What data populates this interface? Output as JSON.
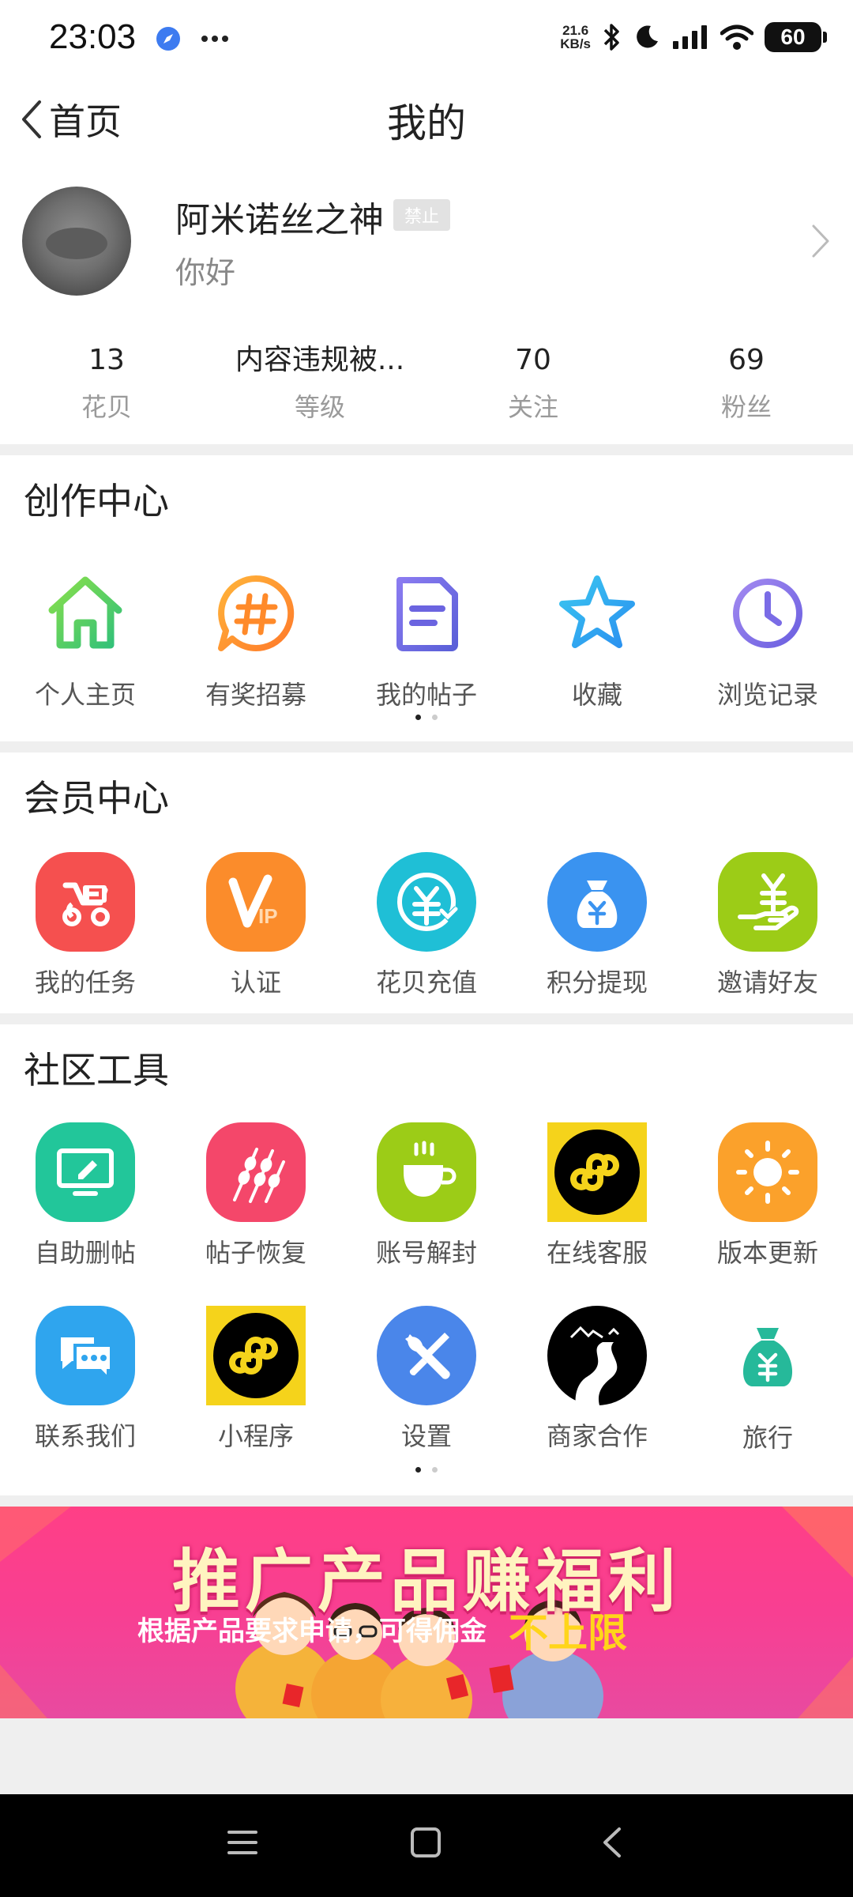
{
  "status_bar": {
    "time": "23:03",
    "net_speed_value": "21.6",
    "net_speed_unit": "KB/s",
    "battery": "60"
  },
  "nav": {
    "back_label": "首页",
    "title": "我的"
  },
  "profile": {
    "username": "阿米诺丝之神",
    "badge": "禁止",
    "signature": "你好",
    "stats": [
      {
        "value": "13",
        "label": "花贝"
      },
      {
        "value": "内容违规被...",
        "label": "等级"
      },
      {
        "value": "70",
        "label": "关注"
      },
      {
        "value": "69",
        "label": "粉丝"
      }
    ]
  },
  "creation_center": {
    "title": "创作中心",
    "items": [
      {
        "label": "个人主页",
        "icon": "home-icon"
      },
      {
        "label": "有奖招募",
        "icon": "hashtag-icon"
      },
      {
        "label": "我的帖子",
        "icon": "document-icon"
      },
      {
        "label": "收藏",
        "icon": "star-icon"
      },
      {
        "label": "浏览记录",
        "icon": "clock-icon"
      }
    ]
  },
  "member_center": {
    "title": "会员中心",
    "items": [
      {
        "label": "我的任务",
        "icon": "task-icon",
        "color": "#f5504f"
      },
      {
        "label": "认证",
        "icon": "vip-icon",
        "color": "#fb8c2b"
      },
      {
        "label": "花贝充值",
        "icon": "recharge-icon",
        "color": "#1fbfd6"
      },
      {
        "label": "积分提现",
        "icon": "money-bag-icon",
        "color": "#3a93f0"
      },
      {
        "label": "邀请好友",
        "icon": "invite-icon",
        "color": "#9ccc17"
      }
    ]
  },
  "community_tools": {
    "title": "社区工具",
    "row1": [
      {
        "label": "自助删帖",
        "icon": "monitor-icon",
        "color": "#22c69a"
      },
      {
        "label": "帖子恢复",
        "icon": "skewer-icon",
        "color": "#f4476a"
      },
      {
        "label": "账号解封",
        "icon": "coffee-icon",
        "color": "#9ccc17"
      },
      {
        "label": "在线客服",
        "icon": "mini-program-icon",
        "color": "#f5d31b"
      },
      {
        "label": "版本更新",
        "icon": "sun-icon",
        "color": "#fba12b"
      }
    ],
    "row2": [
      {
        "label": "联系我们",
        "icon": "chat-icon",
        "color": "#2fa5ee"
      },
      {
        "label": "小程序",
        "icon": "mini-program-icon",
        "color": "#f5d31b"
      },
      {
        "label": "设置",
        "icon": "wrench-icon",
        "color": "#4a86ea"
      },
      {
        "label": "商家合作",
        "icon": "road-icon",
        "color": "#000000"
      },
      {
        "label": "旅行",
        "icon": "money-bag-icon",
        "color": "#26b99a"
      }
    ]
  },
  "banner": {
    "title": "推广产品赚福利",
    "subtitle": "根据产品要求申请，可得佣金",
    "highlight": "不上限"
  }
}
